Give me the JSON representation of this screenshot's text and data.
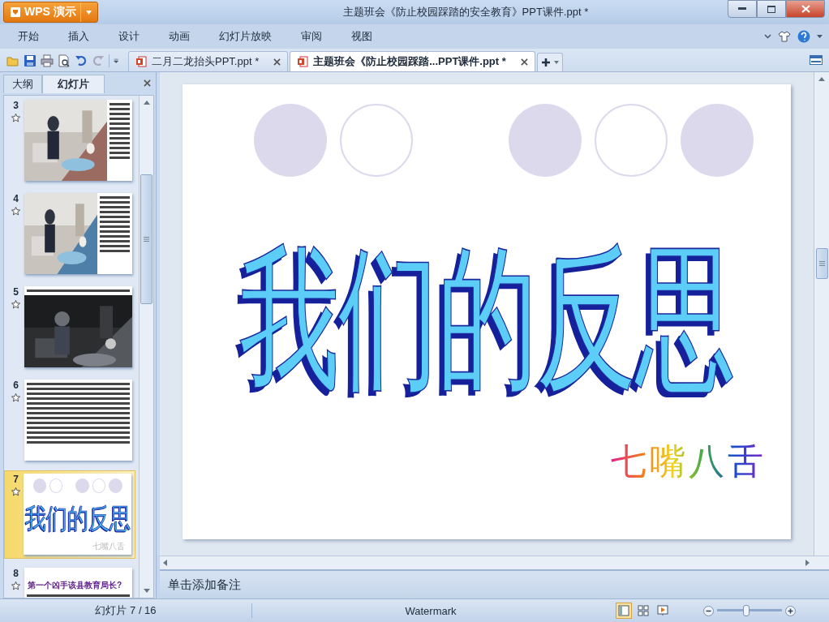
{
  "window": {
    "app_button": "WPS 演示",
    "title": "主题班会《防止校园踩踏的安全教育》PPT课件.ppt *"
  },
  "menu": [
    "开始",
    "插入",
    "设计",
    "动画",
    "幻灯片放映",
    "审阅",
    "视图"
  ],
  "doc_tabs": [
    {
      "label": "二月二龙抬头PPT.ppt *",
      "selected": false
    },
    {
      "label": "主题班会《防止校园踩踏...PPT课件.ppt *",
      "selected": true
    }
  ],
  "panel_tabs": [
    {
      "label": "大纲",
      "selected": false
    },
    {
      "label": "幻灯片",
      "selected": true
    }
  ],
  "thumbnails": [
    {
      "number": "3",
      "kind": "photo-text",
      "selected": false
    },
    {
      "number": "4",
      "kind": "photo-text",
      "selected": false
    },
    {
      "number": "5",
      "selected": false
    },
    {
      "number": "6",
      "kind": "text",
      "selected": false
    },
    {
      "number": "7",
      "kind": "title",
      "selected": true,
      "title": "我们的反思",
      "footer": "七嘴八舌"
    },
    {
      "number": "8",
      "kind": "heading",
      "selected": false,
      "heading": "第一个凶手该县教育局长?"
    }
  ],
  "slide": {
    "circle_groups": [
      [
        {
          "filled": true
        },
        {
          "filled": false
        }
      ],
      [
        {
          "filled": true
        },
        {
          "filled": false
        },
        {
          "filled": true
        }
      ]
    ],
    "title": "我们的反思",
    "signature": "七嘴八舌"
  },
  "notes": {
    "placeholder": "单击添加备注"
  },
  "status_bar": {
    "slide_position": "幻灯片 7 / 16",
    "theme": "Watermark",
    "views": [
      {
        "kind": "normal",
        "selected": true
      },
      {
        "kind": "sorter",
        "selected": false
      },
      {
        "kind": "show",
        "selected": false
      }
    ],
    "zoom": {
      "level": 0.45
    }
  }
}
